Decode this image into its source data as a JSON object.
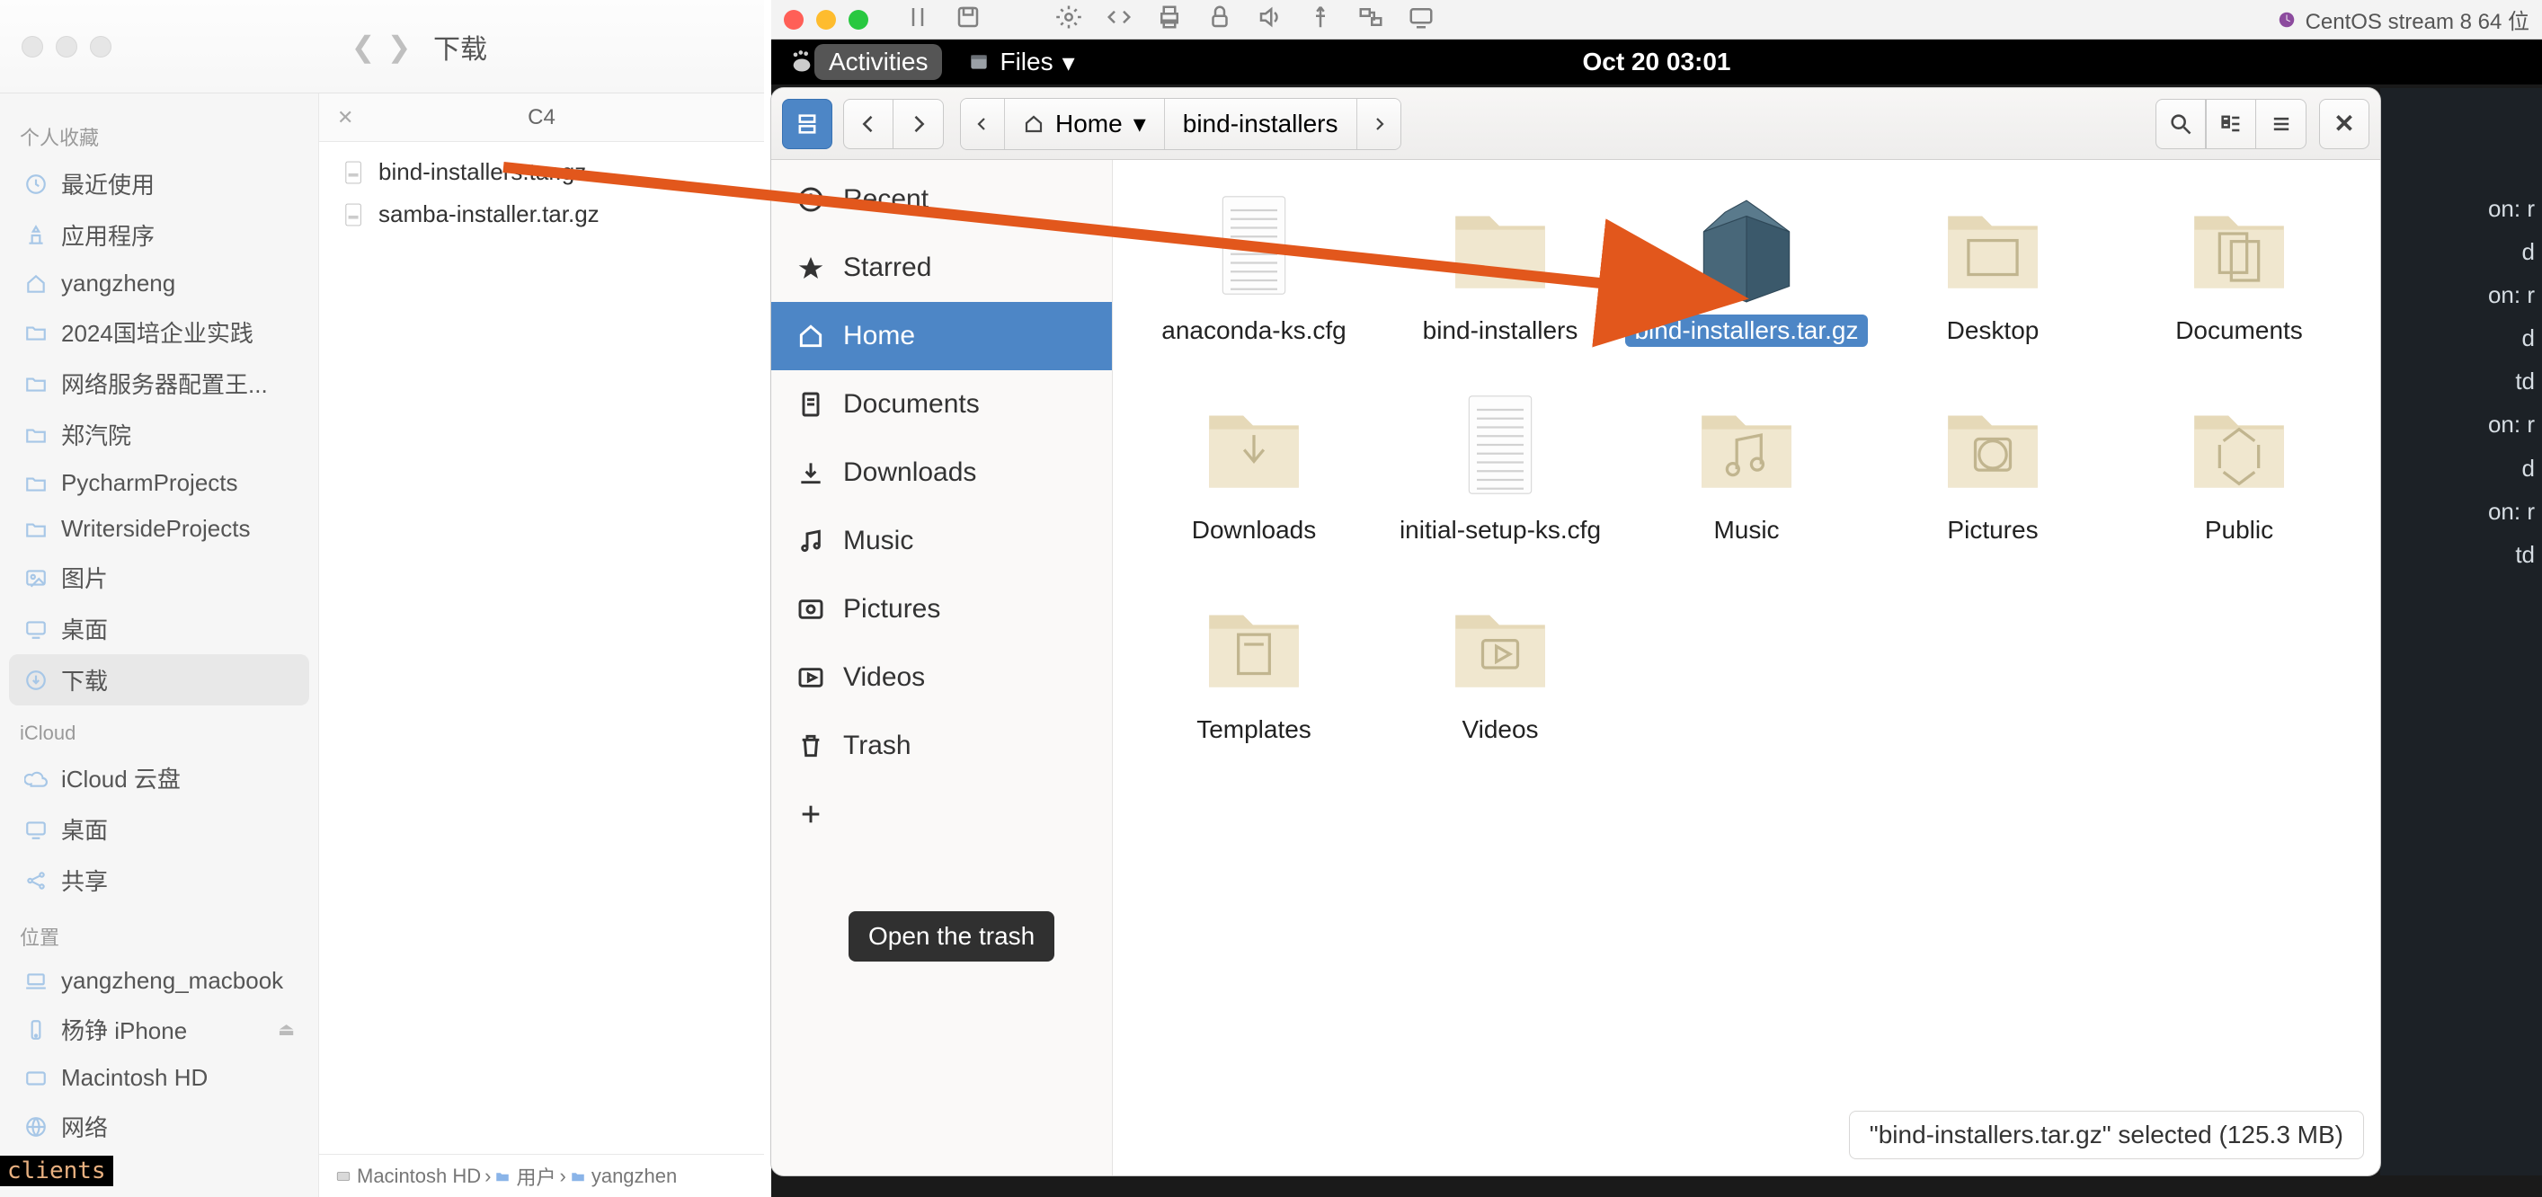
{
  "mac": {
    "title": "下载",
    "tab": "C4",
    "files": [
      {
        "name": "bind-installers.tar.gz"
      },
      {
        "name": "samba-installer.tar.gz"
      }
    ],
    "sidebar": {
      "s1": {
        "header": "个人收藏",
        "items": [
          "最近使用",
          "应用程序",
          "yangzheng",
          "2024国培企业实践",
          "网络服务器配置王...",
          "郑汽院",
          "PycharmProjects",
          "WritersideProjects",
          "图片",
          "桌面",
          "下载"
        ]
      },
      "s2": {
        "header": "iCloud",
        "items": [
          "iCloud 云盘",
          "桌面",
          "共享"
        ]
      },
      "s3": {
        "header": "位置",
        "items": [
          "yangzheng_macbook",
          "杨铮 iPhone",
          "Macintosh HD",
          "网络"
        ]
      }
    },
    "path": [
      "Macintosh HD",
      "用户",
      "yangzhen"
    ]
  },
  "vm": {
    "name": "CentOS stream 8 64 位"
  },
  "gnome": {
    "activities": "Activities",
    "files_label": "Files",
    "clock": "Oct 20  03:01"
  },
  "nautilus": {
    "path": {
      "home": "Home",
      "folder": "bind-installers"
    },
    "sidebar_items": [
      "Recent",
      "Starred",
      "Home",
      "Documents",
      "Downloads",
      "Music",
      "Pictures",
      "Videos",
      "Trash"
    ],
    "other_loc_label": "Open the trash",
    "items": [
      {
        "label": "anaconda-ks.cfg",
        "kind": "file"
      },
      {
        "label": "bind-installers",
        "kind": "folder"
      },
      {
        "label": "bind-installers.tar.gz",
        "kind": "archive",
        "selected": true
      },
      {
        "label": "Desktop",
        "kind": "folder",
        "emblem": "desktop"
      },
      {
        "label": "Documents",
        "kind": "folder",
        "emblem": "documents"
      },
      {
        "label": "Downloads",
        "kind": "folder",
        "emblem": "downloads"
      },
      {
        "label": "initial-setup-ks.cfg",
        "kind": "file"
      },
      {
        "label": "Music",
        "kind": "folder",
        "emblem": "music"
      },
      {
        "label": "Pictures",
        "kind": "folder",
        "emblem": "pictures"
      },
      {
        "label": "Public",
        "kind": "folder",
        "emblem": "public"
      },
      {
        "label": "Templates",
        "kind": "folder",
        "emblem": "templates"
      },
      {
        "label": "Videos",
        "kind": "folder",
        "emblem": "videos"
      }
    ],
    "status": "\"bind-installers.tar.gz\" selected  (125.3 MB)"
  },
  "term_lines": [
    "on: r",
    "d",
    "on: r",
    "d",
    "td",
    "",
    "",
    "on: r",
    "",
    "d",
    "on: r",
    "td"
  ],
  "term_bl": "clients"
}
